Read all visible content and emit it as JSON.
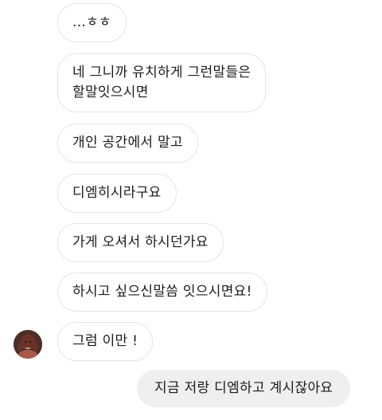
{
  "messages": [
    {
      "direction": "incoming",
      "lines": [
        "...ㅎㅎ"
      ]
    },
    {
      "direction": "incoming",
      "lines": [
        "네 그니까 유치하게  그런말들은",
        "할말잇으시면"
      ]
    },
    {
      "direction": "incoming",
      "lines": [
        "개인 공간에서 말고"
      ]
    },
    {
      "direction": "incoming",
      "lines": [
        "디엠히시라구요"
      ]
    },
    {
      "direction": "incoming",
      "lines": [
        "가게 오셔서 하시던가요"
      ]
    },
    {
      "direction": "incoming",
      "lines": [
        "하시고 싶으신말씀 잇으시면요!"
      ]
    },
    {
      "direction": "incoming",
      "lines": [
        "그럼 이만 !"
      ]
    },
    {
      "direction": "outgoing",
      "lines": [
        "지금 저랑 디엠하고 계시잖아요"
      ]
    }
  ],
  "colors": {
    "incoming_bg": "#ffffff",
    "incoming_border": "#e4e4e4",
    "outgoing_bg": "#efefef",
    "text": "#1a1a1a"
  },
  "icons": {
    "avatar": "profile-picture"
  }
}
